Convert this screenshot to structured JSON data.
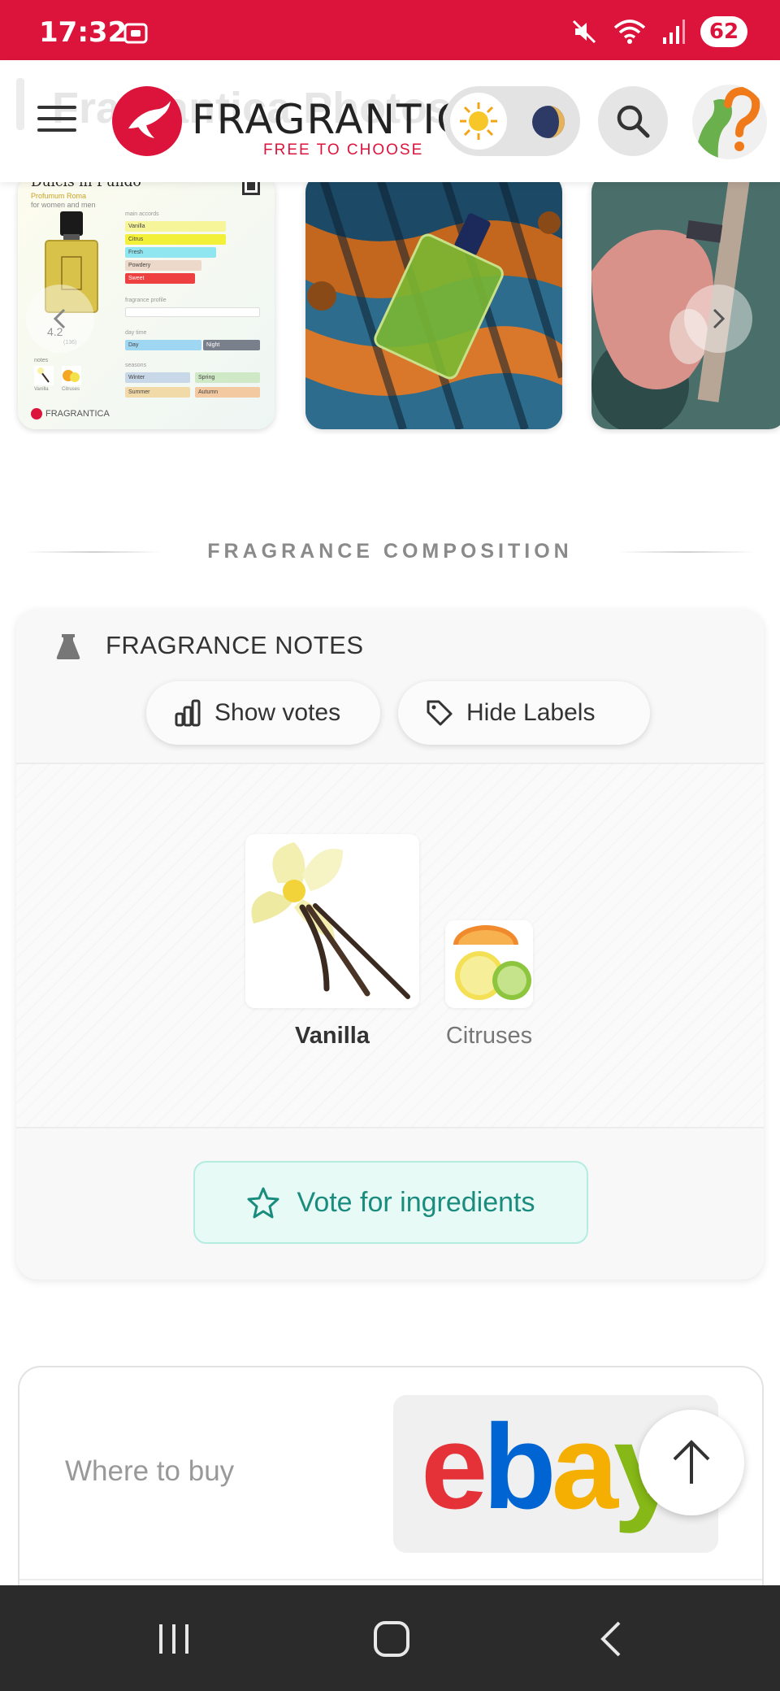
{
  "status_bar": {
    "time": "17:32",
    "battery": "62",
    "icons": [
      "screenshot-icon",
      "mute-icon",
      "wifi-icon",
      "signal-icon",
      "battery-icon"
    ]
  },
  "header": {
    "ghost_title": "Fragrantica Photos",
    "brand": "FRAGRANTICA",
    "tagline": "FREE TO CHOOSE",
    "icons": [
      "menu-icon",
      "hummingbird-logo",
      "sun-icon",
      "moon-icon",
      "search-icon",
      "help-icon"
    ]
  },
  "photos": {
    "card": {
      "title": "Dulcis in Fundo",
      "brand": "Profumum Roma",
      "audience": "for women and men",
      "main_accords_label": "main accords",
      "accords": [
        "Vanilla",
        "Citrus",
        "Fresh",
        "Powdery",
        "Sweet"
      ],
      "profile_label": "fragrance profile",
      "daytime_label": "day time",
      "day": "Day",
      "night": "Night",
      "seasons_label": "seasons",
      "seasons": [
        "Winter",
        "Spring",
        "Summer",
        "Autumn"
      ],
      "rating": "4.2",
      "votes": "(136)",
      "notes_label": "notes",
      "notes": [
        "Vanilla",
        "Citruses"
      ],
      "logo": "FRAGRANTICA"
    }
  },
  "composition": {
    "heading": "FRAGRANCE COMPOSITION",
    "notes_title": "FRAGRANCE NOTES",
    "show_votes": "Show votes",
    "hide_labels": "Hide Labels",
    "notes": [
      {
        "name": "Vanilla"
      },
      {
        "name": "Citruses"
      }
    ],
    "vote_button": "Vote for ingredients"
  },
  "buy": {
    "label": "Where to buy",
    "store": "ebay"
  },
  "colors": {
    "brand_red": "#dc143c",
    "teal": "#1a8c7e"
  }
}
